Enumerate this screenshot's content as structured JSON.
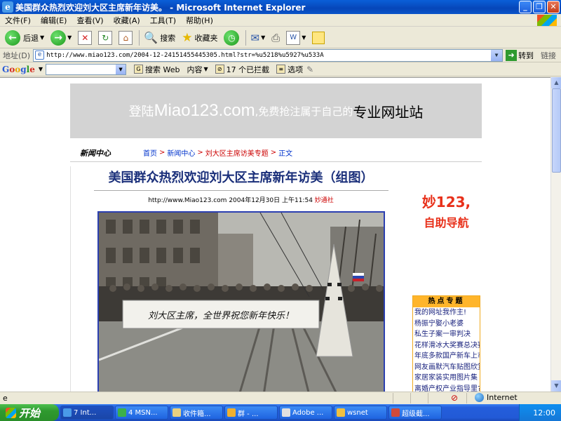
{
  "window": {
    "title": "美国群众热烈欢迎刘大区主席新年访美。 - Microsoft Internet Explorer",
    "ie_icon": "e"
  },
  "menu": [
    "文件(F)",
    "编辑(E)",
    "查看(V)",
    "收藏(A)",
    "工具(T)",
    "帮助(H)"
  ],
  "toolbar": {
    "back_label": "后退",
    "search_label": "搜索",
    "favorites_label": "收藏夹"
  },
  "address": {
    "label": "地址(D)",
    "url": "http://www.miao123.com/2004-12-24151455445305.html?str=%u5218%u5927%u533A",
    "go_label": "转到",
    "links_label": "链接"
  },
  "google": {
    "logo": "Google",
    "search_web": "搜索 Web",
    "content_label": "内容",
    "blocked": "17 个已拦截",
    "options": "选项"
  },
  "page": {
    "banner": {
      "part1": "登陆",
      "domain": "Miao123.com",
      "part2": ",免费抢注属于自己的",
      "part3": "专业网址站"
    },
    "section": "新闻中心",
    "breadcrumb": [
      "首页",
      "新闻中心",
      "刘大区主席访美专题",
      "正文"
    ],
    "headline": "美国群众热烈欢迎刘大区主席新年访美（组图）",
    "meta_source_url": "http://www.Miao123.com",
    "meta_date": "2004年12月30日 上午11:54",
    "meta_author": "妙通社",
    "banner_photo_text": "刘大区主席，全世界祝您新年快乐！",
    "promo_line1": "妙123,",
    "promo_line2": "自助导航",
    "hot_title": "热点专题",
    "hot_links": [
      "我的网址我作主!",
      "杨振宁娶小老婆",
      "私生子案一审判决",
      "花样滑冰大奖赛总决赛",
      "年底多款国产新车上市",
      "网友画默汽车贴图欣赏",
      "家居家装实用图片集",
      "离婚产权产业指导里?"
    ]
  },
  "status": {
    "zone": "Internet"
  },
  "taskbar": {
    "start": "开始",
    "tasks": [
      "7 Int...",
      "4 MSN...",
      "收件箱...",
      "群 - ...",
      "Adobe ...",
      "wsnet",
      "超级截..."
    ],
    "clock": "12:00"
  }
}
